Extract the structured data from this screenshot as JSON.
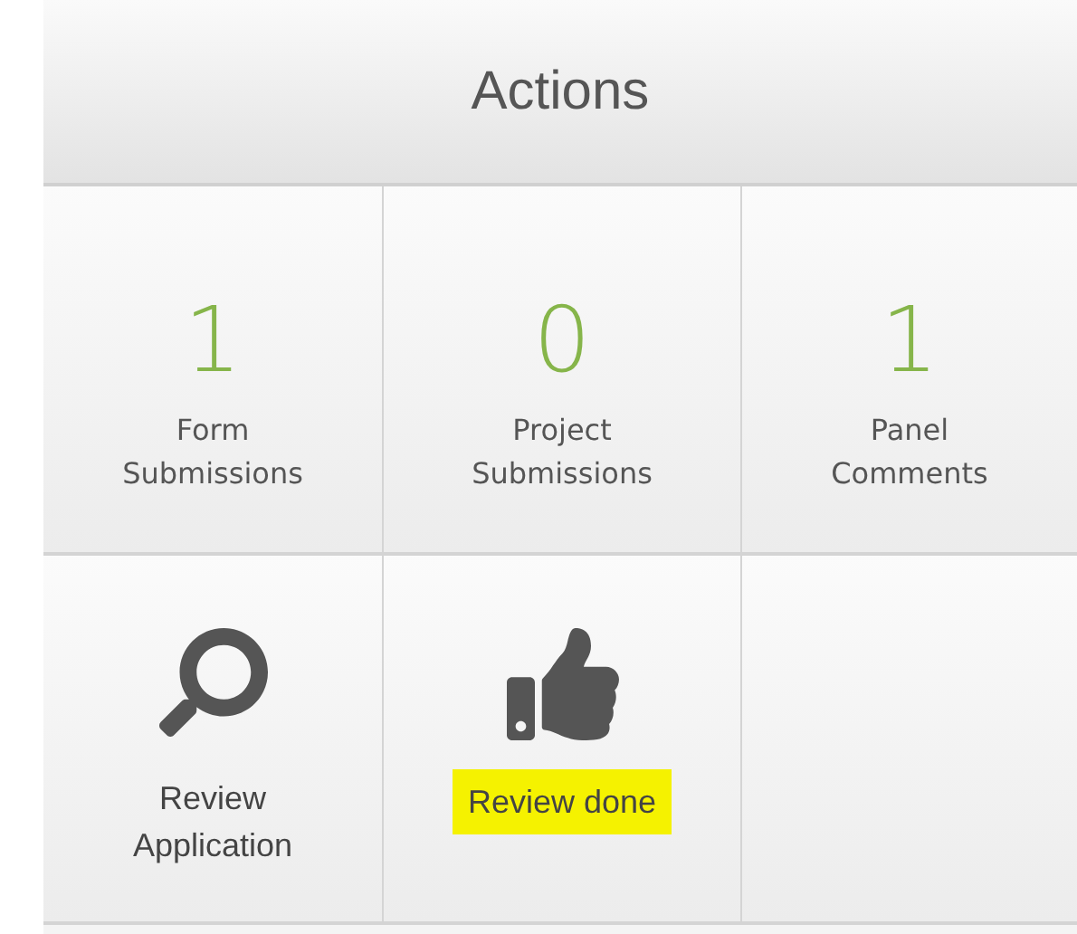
{
  "header": {
    "title": "Actions"
  },
  "tiles": [
    {
      "kind": "stat",
      "count": "1",
      "label_lines": [
        "Form",
        "Submissions"
      ]
    },
    {
      "kind": "stat",
      "count": "0",
      "label_lines": [
        "Project",
        "Submissions"
      ]
    },
    {
      "kind": "stat",
      "count": "1",
      "label_lines": [
        "Panel",
        "Comments"
      ]
    },
    {
      "kind": "action",
      "label_lines": [
        "Review",
        "Application"
      ],
      "highlighted": false
    },
    {
      "kind": "action",
      "label_lines": [
        "Review done"
      ],
      "highlighted": true
    },
    {
      "kind": "empty"
    }
  ]
}
